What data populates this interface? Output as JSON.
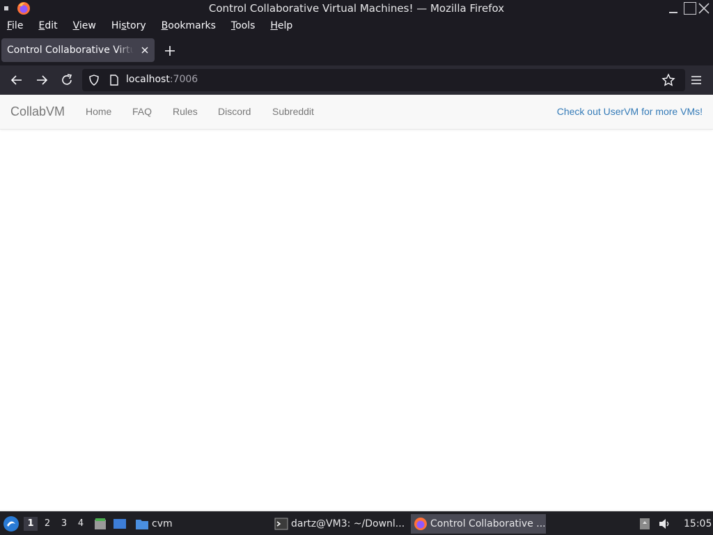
{
  "window": {
    "title": "Control Collaborative Virtual Machines! — Mozilla Firefox"
  },
  "menubar": [
    {
      "accel": "F",
      "rest": "ile"
    },
    {
      "accel": "E",
      "rest": "dit"
    },
    {
      "accel": "V",
      "rest": "iew"
    },
    {
      "pre": "Hi",
      "accel": "s",
      "rest": "tory"
    },
    {
      "accel": "B",
      "rest": "ookmarks"
    },
    {
      "accel": "T",
      "rest": "ools"
    },
    {
      "accel": "H",
      "rest": "elp"
    }
  ],
  "tab": {
    "title": "Control Collaborative Virtual Machines!"
  },
  "urlbar": {
    "host": "localhost",
    "port": ":7006"
  },
  "site_nav": {
    "brand": "CollabVM",
    "links": [
      "Home",
      "FAQ",
      "Rules",
      "Discord",
      "Subreddit"
    ],
    "promo": "Check out UserVM for more VMs!"
  },
  "taskbar": {
    "workspaces": [
      "1",
      "2",
      "3",
      "4"
    ],
    "folder_label": "cvm",
    "terminal_task": "dartz@VM3: ~/Downl...",
    "firefox_task": "Control Collaborative ...",
    "clock": "15:05"
  },
  "colors": {
    "chrome_dark": "#1c1b22",
    "toolbar": "#2b2a33",
    "tab_active": "#42414d",
    "site_nav_bg": "#f8f8f8",
    "link_gray": "#777777",
    "promo_link": "#337ab7"
  }
}
